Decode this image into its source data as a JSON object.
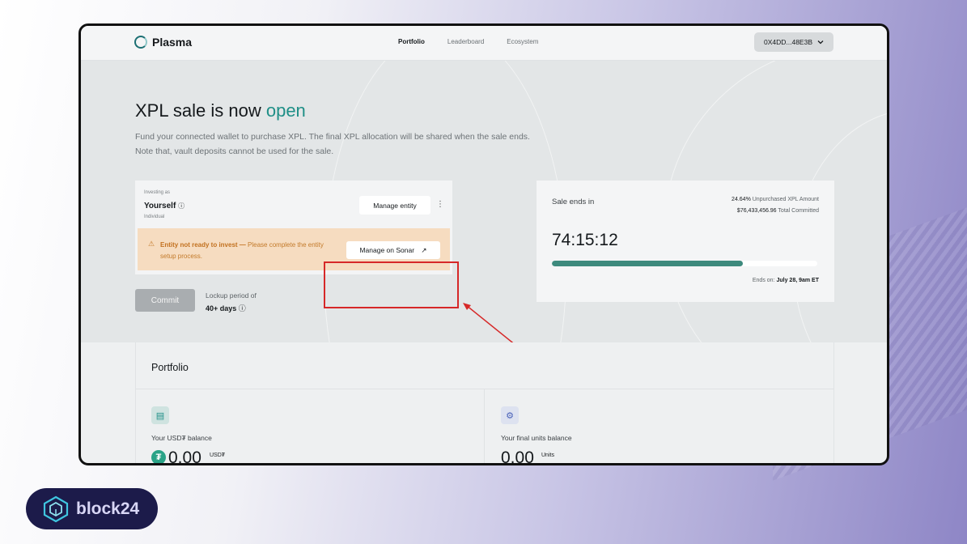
{
  "nav": {
    "logo": "Plasma",
    "links": [
      {
        "label": "Portfolio",
        "active": true
      },
      {
        "label": "Leaderboard",
        "active": false
      },
      {
        "label": "Ecosystem",
        "active": false
      }
    ],
    "wallet": "0X4DD...48E3B"
  },
  "hero": {
    "title": "XPL sale is now",
    "title_highlight": "open",
    "desc_line1": "Fund your connected wallet to purchase XPL. The final XPL allocation will be shared when the sale ends.",
    "desc_line2": "Note that, vault deposits cannot be used for the sale."
  },
  "entity": {
    "investing_as": "Investing as",
    "name": "Yourself",
    "type": "Individual",
    "manage_label": "Manage entity",
    "warning_bold": "Entity not ready to invest —",
    "warning_rest": "Please complete the entity setup process.",
    "sonar_label": "Manage on Sonar"
  },
  "commit": {
    "button_label": "Commit",
    "lockup_label": "Lockup period of",
    "lockup_value": "40+ days"
  },
  "sale": {
    "ends_in_label": "Sale ends in",
    "unpurchased_value": "24.64%",
    "unpurchased_label": "Unpurchased XPL Amount",
    "committed_value": "$76,433,456.96",
    "committed_label": "Total Committed",
    "timer": "74:15:12",
    "progress_fraction": 0.72,
    "ends_on_label": "Ends on:",
    "ends_on_value": "July 28, 9am ET"
  },
  "portfolio": {
    "title": "Portfolio",
    "usdt_label": "Your USD₮ balance",
    "usdt_amount": "0.00",
    "usdt_unit": "USD₮",
    "units_label": "Your final units balance",
    "units_amount": "0.00",
    "units_unit": "Units"
  },
  "brand": {
    "name": "block24"
  },
  "colors": {
    "accent": "#1f8f87",
    "progress": "#3d8a7d",
    "warning_bg": "#f6dcc0",
    "warning_text": "#c37a2a",
    "highlight": "#d62828"
  }
}
